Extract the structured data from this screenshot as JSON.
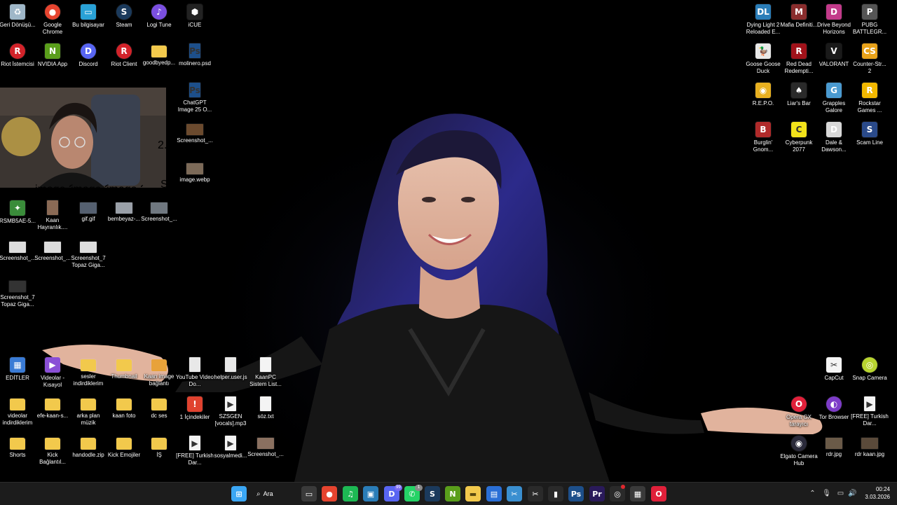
{
  "desktop_left": [
    {
      "label": "Geri Dönüşü...",
      "icon": "recycle-bin-icon",
      "kind": "app",
      "color": "#9fb7c8",
      "glyph": "♻"
    },
    {
      "label": "Google Chrome",
      "icon": "chrome-icon",
      "kind": "round",
      "color": "#e6442f",
      "glyph": "●"
    },
    {
      "label": "Bu bilgisayar",
      "icon": "computer-icon",
      "kind": "app",
      "color": "#29a1d6",
      "glyph": "▭"
    },
    {
      "label": "Steam",
      "icon": "steam-icon",
      "kind": "round",
      "color": "#1b3a5c",
      "glyph": "S"
    },
    {
      "label": "Logi Tune",
      "icon": "logi-tune-icon",
      "kind": "round",
      "color": "#7b4fe0",
      "glyph": "♪"
    },
    {
      "label": "iCUE",
      "icon": "icue-icon",
      "kind": "app",
      "color": "#222",
      "glyph": "⬢"
    },
    {
      "label": "Riot İstemcisi",
      "icon": "riot-client-icon",
      "kind": "round",
      "color": "#d2232a",
      "glyph": "R"
    },
    {
      "label": "NVIDIA App",
      "icon": "nvidia-icon",
      "kind": "app",
      "color": "#5a9e1b",
      "glyph": "N"
    },
    {
      "label": "Discord",
      "icon": "discord-icon",
      "kind": "round",
      "color": "#5865f2",
      "glyph": "D"
    },
    {
      "label": "Riot Client",
      "icon": "riot-client-icon",
      "kind": "round",
      "color": "#d2232a",
      "glyph": "R"
    },
    {
      "label": "goodbyedp...",
      "icon": "folder-icon",
      "kind": "folder",
      "color": "#f2c94c",
      "glyph": ""
    },
    {
      "label": "molinero.psd",
      "icon": "photoshop-file-icon",
      "kind": "doc",
      "color": "#1d4f8a",
      "glyph": "Ps"
    },
    {
      "label": "ChatGPT Image 25 O...",
      "icon": "photoshop-file-icon",
      "kind": "doc",
      "color": "#1d4f8a",
      "glyph": "Ps"
    },
    {
      "label": "Screenshot_...",
      "icon": "image-file-icon",
      "kind": "thumb",
      "color": "#6b4a2e",
      "glyph": ""
    },
    {
      "label": "image.webp",
      "icon": "image-file-icon",
      "kind": "thumb",
      "color": "#7c6a58",
      "glyph": ""
    },
    {
      "label": "RSMB5AE-5...",
      "icon": "image-file-icon",
      "kind": "app",
      "color": "#3a8c3a",
      "glyph": "✦"
    },
    {
      "label": "Kaan Hayranlık....",
      "icon": "image-file-icon",
      "kind": "doc",
      "color": "#8a6a55",
      "glyph": ""
    },
    {
      "label": "gif.gif",
      "icon": "gif-file-icon",
      "kind": "thumb",
      "color": "#556070",
      "glyph": ""
    },
    {
      "label": "bembeyaz-...",
      "icon": "image-file-icon",
      "kind": "thumb",
      "color": "#9aa0a8",
      "glyph": ""
    },
    {
      "label": "Screenshot_...",
      "icon": "image-file-icon",
      "kind": "thumb",
      "color": "#707880",
      "glyph": ""
    },
    {
      "label": "Screenshot_...",
      "icon": "image-file-icon",
      "kind": "thumb",
      "color": "#dddddd",
      "glyph": ""
    },
    {
      "label": "Screenshot_...",
      "icon": "image-file-icon",
      "kind": "thumb",
      "color": "#dddddd",
      "glyph": ""
    },
    {
      "label": "Screenshot_7 Topaz Giga...",
      "icon": "image-file-icon",
      "kind": "thumb",
      "color": "#dddddd",
      "glyph": ""
    },
    {
      "label": "Screenshot_7 Topaz Giga...",
      "icon": "image-file-icon",
      "kind": "thumb",
      "color": "#333333",
      "glyph": ""
    }
  ],
  "webcam_partial_labels": [
    "image 26 O...",
    "image 2025...",
    "image 25 O...",
    "2...",
    "SF..."
  ],
  "desktop_bottom": [
    {
      "label": "EDİTLER",
      "icon": "video-folder-icon",
      "kind": "app",
      "color": "#3a7bd5",
      "glyph": "▦"
    },
    {
      "label": "Videolar - Kısayol",
      "icon": "shortcut-icon",
      "kind": "app",
      "color": "#8a4fd6",
      "glyph": "▶"
    },
    {
      "label": "sesler indirdiklerim",
      "icon": "folder-icon",
      "kind": "folder",
      "color": "#f2c94c",
      "glyph": ""
    },
    {
      "label": "Thumbnail",
      "icon": "folder-icon",
      "kind": "folder",
      "color": "#f2c94c",
      "glyph": ""
    },
    {
      "label": "Kaan image bağlantı",
      "icon": "folder-icon",
      "kind": "folder",
      "color": "#e8a23a",
      "glyph": ""
    },
    {
      "label": "YouTube Video Do...",
      "icon": "downloader-icon",
      "kind": "doc",
      "color": "#e8e8e8",
      "glyph": ""
    },
    {
      "label": "helper.user.js",
      "icon": "script-file-icon",
      "kind": "doc",
      "color": "#e8e8e8",
      "glyph": ""
    },
    {
      "label": "KaanPC Sistem List...",
      "icon": "text-file-icon",
      "kind": "doc",
      "color": "#f4f4f4",
      "glyph": ""
    },
    {
      "label": "videolar indirdiklerim",
      "icon": "folder-icon",
      "kind": "folder",
      "color": "#f2c94c",
      "glyph": ""
    },
    {
      "label": "efe-kaan-s...",
      "icon": "folder-icon",
      "kind": "folder",
      "color": "#f2c94c",
      "glyph": ""
    },
    {
      "label": "arka plan müzik",
      "icon": "folder-icon",
      "kind": "folder",
      "color": "#f2c94c",
      "glyph": ""
    },
    {
      "label": "kaan foto",
      "icon": "folder-icon",
      "kind": "folder",
      "color": "#f2c94c",
      "glyph": ""
    },
    {
      "label": "dc ses",
      "icon": "folder-icon",
      "kind": "folder",
      "color": "#f2c94c",
      "glyph": ""
    },
    {
      "label": "1 İçindekiler",
      "icon": "shortcut-icon",
      "kind": "app",
      "color": "#e0422f",
      "glyph": "!"
    },
    {
      "label": "SZSGEN [vocals].mp3",
      "icon": "audio-file-icon",
      "kind": "doc",
      "color": "#f4f4f4",
      "glyph": "▶"
    },
    {
      "label": "söz.txt",
      "icon": "text-file-icon",
      "kind": "doc",
      "color": "#f4f4f4",
      "glyph": ""
    },
    {
      "label": "Shorts",
      "icon": "folder-icon",
      "kind": "folder",
      "color": "#f2c94c",
      "glyph": ""
    },
    {
      "label": "Kick Bağlantıl...",
      "icon": "folder-icon",
      "kind": "folder",
      "color": "#f2c94c",
      "glyph": ""
    },
    {
      "label": "handodle.zip",
      "icon": "zip-file-icon",
      "kind": "folder",
      "color": "#f2c94c",
      "glyph": ""
    },
    {
      "label": "Kick Emojiler",
      "icon": "folder-icon",
      "kind": "folder",
      "color": "#f2c94c",
      "glyph": ""
    },
    {
      "label": "İŞ",
      "icon": "folder-icon",
      "kind": "folder",
      "color": "#f2c94c",
      "glyph": ""
    },
    {
      "label": "[FREE] Turkish Dar...",
      "icon": "audio-file-icon",
      "kind": "doc",
      "color": "#f4f4f4",
      "glyph": "▶"
    },
    {
      "label": "sosyalmedi...",
      "icon": "audio-file-icon",
      "kind": "doc",
      "color": "#f4f4f4",
      "glyph": "▶"
    },
    {
      "label": "Screenshot_...",
      "icon": "image-file-icon",
      "kind": "thumb",
      "color": "#8a7060",
      "glyph": ""
    }
  ],
  "desktop_right": [
    {
      "label": "Dying Light 2 Reloaded E...",
      "icon": "game-icon",
      "kind": "app",
      "color": "#2a7db8",
      "glyph": "DL"
    },
    {
      "label": "Mafia Definiti...",
      "icon": "game-icon",
      "kind": "app",
      "color": "#8a2d2d",
      "glyph": "M"
    },
    {
      "label": "Drive Beyond Horizons",
      "icon": "game-icon",
      "kind": "app",
      "color": "#c23a8a",
      "glyph": "D"
    },
    {
      "label": "PUBG BATTLEGR...",
      "icon": "game-icon",
      "kind": "app",
      "color": "#555",
      "glyph": "P"
    },
    {
      "label": "Goose Goose Duck",
      "icon": "game-icon",
      "kind": "app",
      "color": "#e8e8e8",
      "glyph": "🦆"
    },
    {
      "label": "Red Dead Redempti...",
      "icon": "game-icon",
      "kind": "app",
      "color": "#a1121a",
      "glyph": "R"
    },
    {
      "label": "VALORANT",
      "icon": "valorant-icon",
      "kind": "app",
      "color": "#1a1a1a",
      "glyph": "V"
    },
    {
      "label": "Counter-Str... 2",
      "icon": "cs2-icon",
      "kind": "app",
      "color": "#e8a21a",
      "glyph": "CS"
    },
    {
      "label": "R.E.P.O.",
      "icon": "game-icon",
      "kind": "app",
      "color": "#e8b020",
      "glyph": "◉"
    },
    {
      "label": "Liar's Bar",
      "icon": "game-icon",
      "kind": "app",
      "color": "#2a2a2a",
      "glyph": "♠"
    },
    {
      "label": "Grapples Galore",
      "icon": "game-icon",
      "kind": "app",
      "color": "#4a9ad0",
      "glyph": "G"
    },
    {
      "label": "Rockstar Games ...",
      "icon": "rockstar-icon",
      "kind": "app",
      "color": "#f2b800",
      "glyph": "R"
    },
    {
      "label": "Burglin' Gnom...",
      "icon": "game-icon",
      "kind": "app",
      "color": "#b02a2a",
      "glyph": "B"
    },
    {
      "label": "Cyberpunk 2077",
      "icon": "game-icon",
      "kind": "app",
      "color": "#f2e21a",
      "glyph": "C"
    },
    {
      "label": "Dale & Dawson...",
      "icon": "game-icon",
      "kind": "app",
      "color": "#d8d8d8",
      "glyph": "D"
    },
    {
      "label": "Scam Line",
      "icon": "game-icon",
      "kind": "app",
      "color": "#2a4a8a",
      "glyph": "S"
    }
  ],
  "desktop_right_bottom": [
    {
      "label": "CapCut",
      "icon": "capcut-icon",
      "kind": "app",
      "color": "#f4f4f4",
      "glyph": "✂"
    },
    {
      "label": "Snap Camera",
      "icon": "snap-camera-icon",
      "kind": "round",
      "color": "#b8d430",
      "glyph": "◎"
    },
    {
      "label": "Opera GX tarayıcı",
      "icon": "opera-gx-icon",
      "kind": "round",
      "color": "#e0203a",
      "glyph": "O"
    },
    {
      "label": "Tor Browser",
      "icon": "tor-icon",
      "kind": "round",
      "color": "#7d3cc8",
      "glyph": "◐"
    },
    {
      "label": "[FREE] Turkish Dar...",
      "icon": "audio-file-icon",
      "kind": "doc",
      "color": "#f4f4f4",
      "glyph": "▶"
    },
    {
      "label": "Elgato Camera Hub",
      "icon": "elgato-icon",
      "kind": "round",
      "color": "#2a2a3a",
      "glyph": "◉"
    },
    {
      "label": "rdr.jpg",
      "icon": "image-file-icon",
      "kind": "thumb",
      "color": "#6a5a48",
      "glyph": ""
    },
    {
      "label": "rdr kaan.jpg",
      "icon": "image-file-icon",
      "kind": "thumb",
      "color": "#5a4a3a",
      "glyph": ""
    }
  ],
  "taskbar": {
    "search_label": "Ara",
    "apps": [
      {
        "name": "start-button",
        "color": "#3ba7f5",
        "glyph": "⊞"
      },
      {
        "name": "task-view-icon",
        "color": "#3a3a3a",
        "glyph": "▭"
      },
      {
        "name": "chrome-icon",
        "color": "#e6442f",
        "glyph": "●"
      },
      {
        "name": "spotify-icon",
        "color": "#1db954",
        "glyph": "♫"
      },
      {
        "name": "photos-icon",
        "color": "#2a7db8",
        "glyph": "▣"
      },
      {
        "name": "discord-icon",
        "color": "#5865f2",
        "glyph": "D",
        "badge": "99"
      },
      {
        "name": "whatsapp-icon",
        "color": "#25d366",
        "glyph": "✆",
        "badge": "1"
      },
      {
        "name": "steam-icon",
        "color": "#1b3a5c",
        "glyph": "S"
      },
      {
        "name": "nvidia-icon",
        "color": "#5a9e1b",
        "glyph": "N"
      },
      {
        "name": "file-explorer-icon",
        "color": "#f2c94c",
        "glyph": "▬"
      },
      {
        "name": "store-icon",
        "color": "#2a6fd6",
        "glyph": "▤"
      },
      {
        "name": "snipping-tool-icon",
        "color": "#3a8fd0",
        "glyph": "✂"
      },
      {
        "name": "capcut-icon",
        "color": "#2a2a2a",
        "glyph": "✂"
      },
      {
        "name": "audio-app-icon",
        "color": "#2a2a2a",
        "glyph": "▮"
      },
      {
        "name": "photoshop-icon",
        "color": "#1d4f8a",
        "glyph": "Ps"
      },
      {
        "name": "premiere-icon",
        "color": "#2a1a5a",
        "glyph": "Pr"
      },
      {
        "name": "obs-icon",
        "color": "#2a2a2a",
        "glyph": "◎",
        "dot": true
      },
      {
        "name": "calculator-icon",
        "color": "#3a3a3a",
        "glyph": "▦"
      },
      {
        "name": "opera-gx-icon",
        "color": "#e0203a",
        "glyph": "O"
      }
    ],
    "time": "00:24",
    "date": "3.03.2026"
  }
}
